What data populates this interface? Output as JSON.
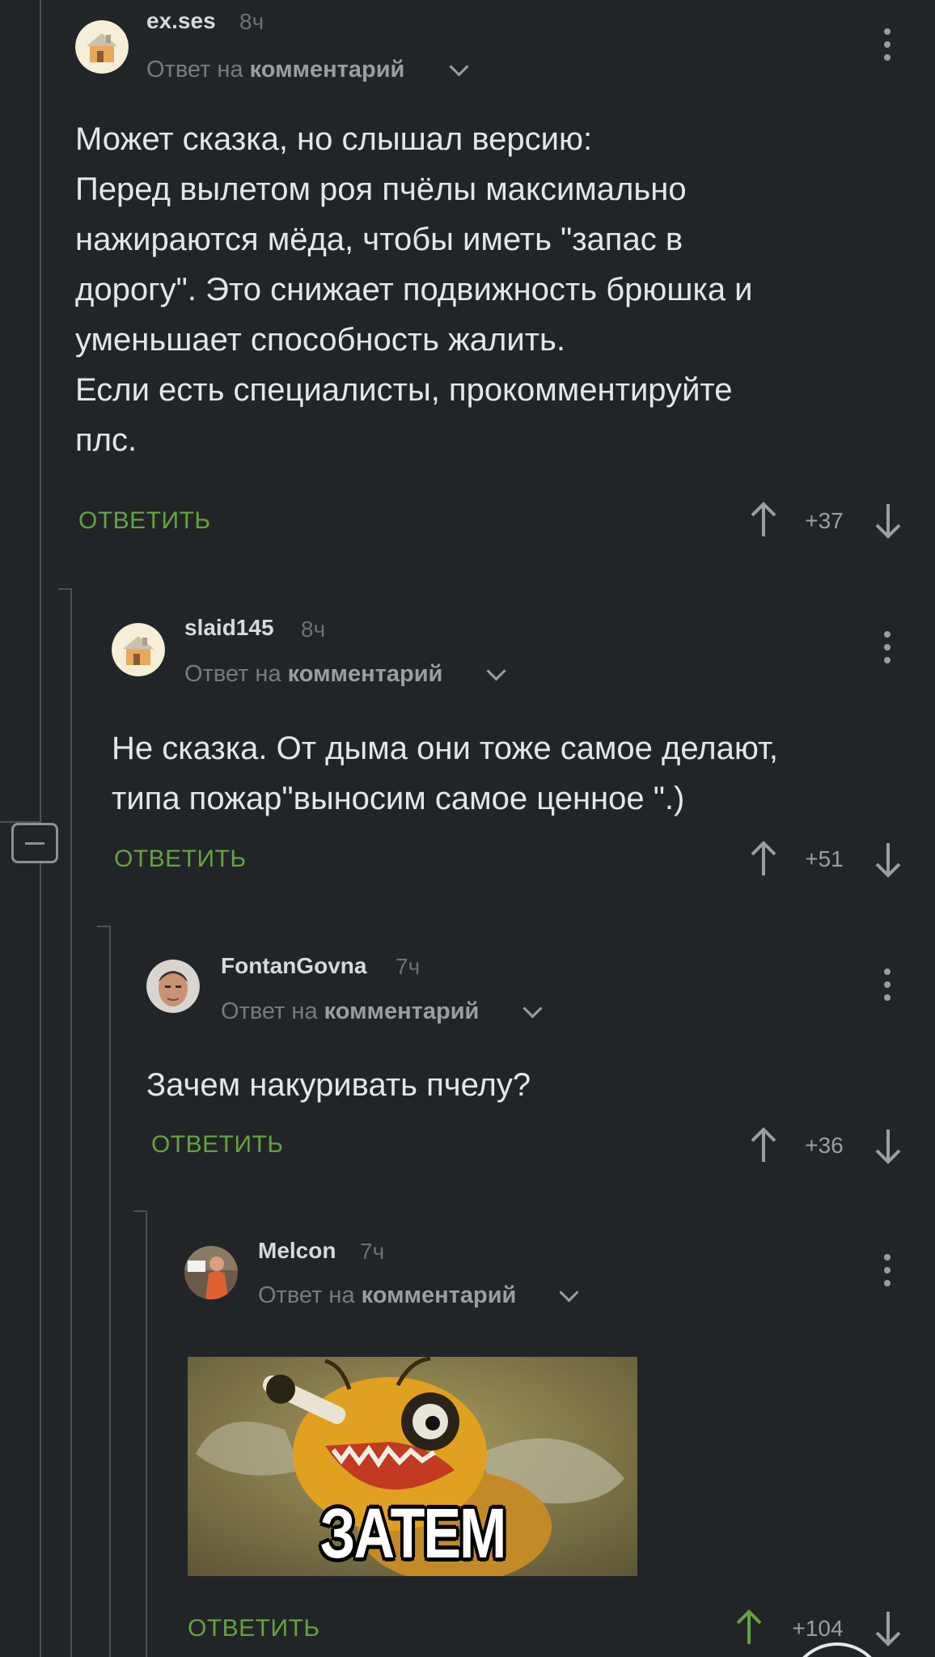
{
  "comments": [
    {
      "username": "ex.ses",
      "time": "8ч",
      "reply_prefix": "Ответ на",
      "reply_target": "комментарий",
      "text": "Может сказка, но слышал версию:\nПеред вылетом роя пчёлы максимально\nнажираются мёда, чтобы иметь \"запас в\nдорогу\". Это снижает подвижность брюшка и\nуменьшает способность жалить.\nЕсли есть специалисты, прокомментируйте\nплс.",
      "reply_label": "ОТВЕТИТЬ",
      "rating": "+37",
      "avatar": "house-icon"
    },
    {
      "username": "slaid145",
      "time": "8ч",
      "reply_prefix": "Ответ на",
      "reply_target": "комментарий",
      "text": "Не сказка. От дыма они тоже самое делают,\nтипа пожар\"выносим самое ценное \".)",
      "reply_label": "ОТВЕТИТЬ",
      "rating": "+51",
      "avatar": "house-icon"
    },
    {
      "username": "FontanGovna",
      "time": "7ч",
      "reply_prefix": "Ответ на",
      "reply_target": "комментарий",
      "text": "Зачем накуривать пчелу?",
      "reply_label": "ОТВЕТИТЬ",
      "rating": "+36",
      "avatar": "face-photo"
    },
    {
      "username": "Melcon",
      "time": "7ч",
      "reply_prefix": "Ответ на",
      "reply_target": "комментарий",
      "image_caption": "ЗАТЕМ",
      "reply_label": "ОТВЕТИТЬ",
      "rating": "+104",
      "avatar": "person-photo"
    }
  ],
  "colors": {
    "background": "#222528",
    "reply_green": "#65a33e",
    "upvote_active": "#65a33e",
    "thread_line": "#4b5057"
  }
}
